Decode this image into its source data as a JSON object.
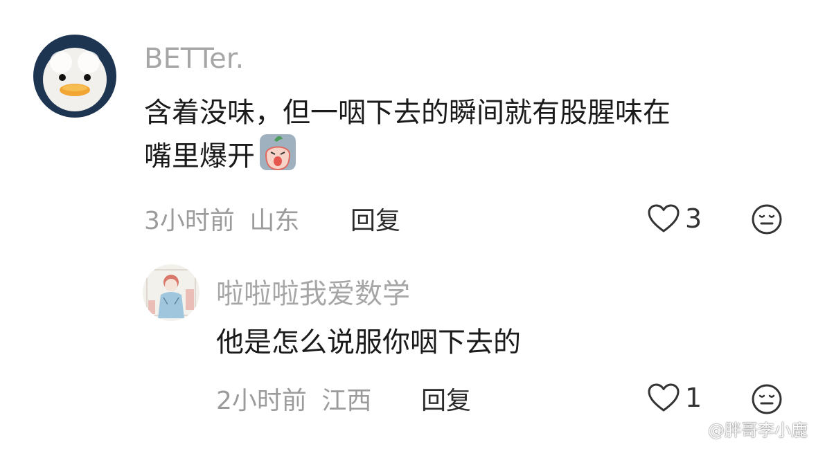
{
  "comments": [
    {
      "username": "BETTer.",
      "text_line1": "含着没味，但一咽下去的瞬间就有股腥味在",
      "text_line2": "嘴里爆开",
      "time": "3小时前",
      "location": "山东",
      "reply_label": "回复",
      "likes": "3",
      "emoji_name": "crying-radish-emoji"
    },
    {
      "username": "啦啦啦我爱数学",
      "text": "他是怎么说服你咽下去的",
      "time": "2小时前",
      "location": "江西",
      "reply_label": "回复",
      "likes": "1"
    }
  ],
  "watermark": {
    "text": "@胖哥李小鹿"
  },
  "colors": {
    "username": "#a6a6a6",
    "body_text": "#1a1a1a",
    "meta": "#9b9b9b",
    "icon_stroke": "#333333"
  }
}
